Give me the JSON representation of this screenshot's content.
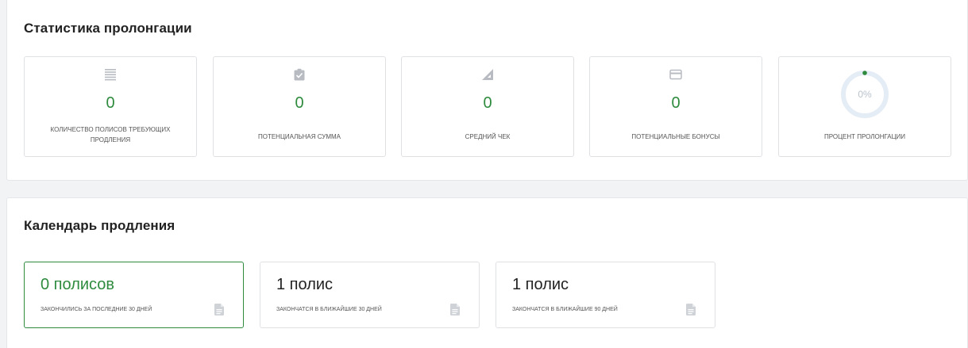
{
  "stats": {
    "title": "Статистика пролонгации",
    "cards": [
      {
        "icon": "list-icon",
        "value": "0",
        "label": "количество полисов требующих продления"
      },
      {
        "icon": "clipboard-check-icon",
        "value": "0",
        "label": "потенциальная сумма"
      },
      {
        "icon": "triangle-ruler-icon",
        "value": "0",
        "label": "средний чек"
      },
      {
        "icon": "credit-card-icon",
        "value": "0",
        "label": "потенциальные бонусы"
      },
      {
        "icon": "progress-ring-icon",
        "value": "0%",
        "progress": 0,
        "label": "процент пролонгации"
      }
    ]
  },
  "calendar": {
    "title": "Календарь продления",
    "cards": [
      {
        "count": "0 полисов",
        "label": "закончились за последние 30 дней",
        "icon": "document-icon",
        "active": true
      },
      {
        "count": "1 полис",
        "label": "закончатся в ближайшие 30 дней",
        "icon": "document-icon",
        "active": false
      },
      {
        "count": "1 полис",
        "label": "закончатся в ближайшие 90 дней",
        "icon": "document-icon",
        "active": false
      }
    ]
  },
  "colors": {
    "accent": "#2e8b3e",
    "icon_gray": "#b8bcc2",
    "ring_track": "#e4ecf5"
  }
}
